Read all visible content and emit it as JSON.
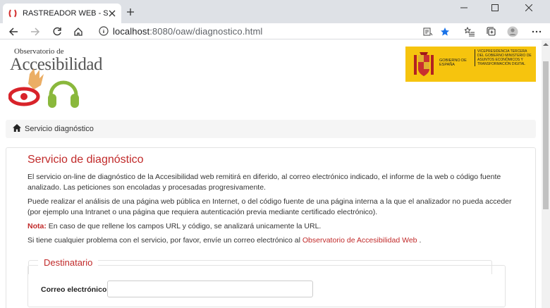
{
  "browser": {
    "tab_title": "RASTREADOR WEB - Servicio de",
    "url_host": "localhost",
    "url_path": ":8080/oaw/diagnostico.html",
    "favicon": "observatorio-favicon",
    "accent": "#1a73e8"
  },
  "header": {
    "logo_small": "Observatorio de",
    "logo_big": "Accesibilidad",
    "gov_left": "GOBIERNO DE ESPAÑA",
    "gov_right": "VICEPRESIDENCIA TERCERA DEL GOBIERNO MINISTERIO DE ASUNTOS ECONÓMICOS Y TRANSFORMACIÓN DIGITAL"
  },
  "breadcrumb": {
    "label": "Servicio diagnóstico"
  },
  "main": {
    "title": "Servicio de diagnóstico",
    "para1": "El servicio on-line de diagnóstico de la Accesibilidad web remitirá en diferido, al correo electrónico indicado, el informe de la web o código fuente analizado. Las peticiones son encoladas y procesadas progresivamente.",
    "para2": "Puede realizar el análisis de una página web pública en Internet, o del código fuente de una página interna a la que el analizador no pueda acceder (por ejemplo una Intranet o una página que requiera autenticación previa mediante certificado electrónico).",
    "nota_label": "Nota:",
    "nota_text": " En caso de que rellene los campos URL y código, se analizará unicamente la URL.",
    "para4_before": "Si tiene cualquier problema con el servicio, por favor, envíe un correo electrónico al ",
    "para4_link": "Observatorio de Accesibilidad Web",
    "para4_after": " .",
    "accent": "#c12a2a"
  },
  "form": {
    "legend": "Destinatario",
    "email_label": "Correo electrónico:",
    "email_value": ""
  }
}
